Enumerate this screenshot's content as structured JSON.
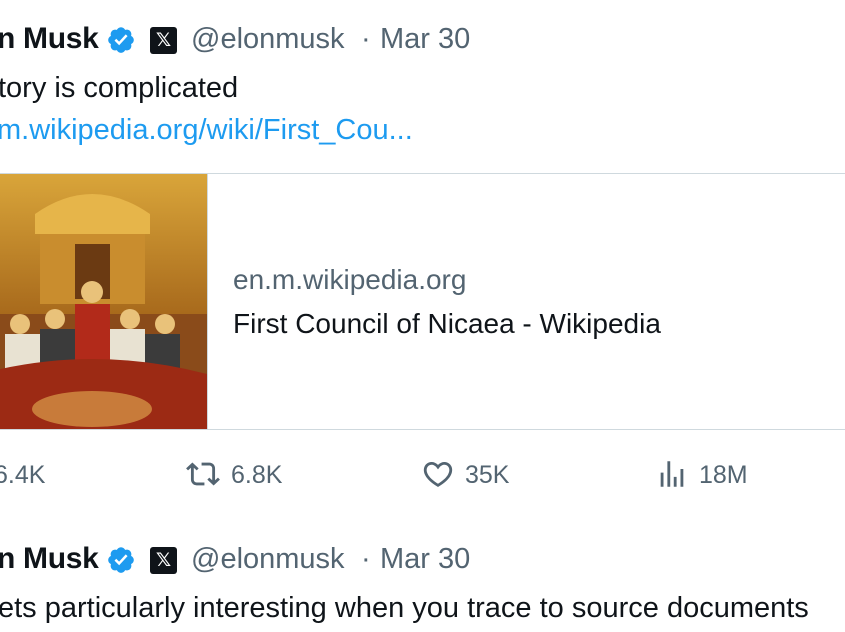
{
  "tweets": [
    {
      "author_name": "n Musk",
      "handle": "@elonmusk",
      "separator": "·",
      "date": "Mar 30",
      "x_badge": "𝕏",
      "text": "tory is complicated",
      "link": "m.wikipedia.org/wiki/First_Cou...",
      "card": {
        "domain": "en.m.wikipedia.org",
        "title": "First Council of Nicaea - Wikipedia",
        "image_icon": "icon-painting-thumbnail"
      },
      "actions": {
        "replies": "6.4K",
        "retweets": "6.8K",
        "likes": "35K",
        "views": "18M"
      }
    },
    {
      "author_name": "n Musk",
      "handle": "@elonmusk",
      "separator": "·",
      "date": "Mar 30",
      "x_badge": "𝕏",
      "text": "ets particularly interesting when you trace to source documents"
    }
  ],
  "colors": {
    "text": "#0f1419",
    "secondary": "#536471",
    "link": "#1d9bf0",
    "verified": "#1d9bf0",
    "border": "#cfd9de"
  }
}
